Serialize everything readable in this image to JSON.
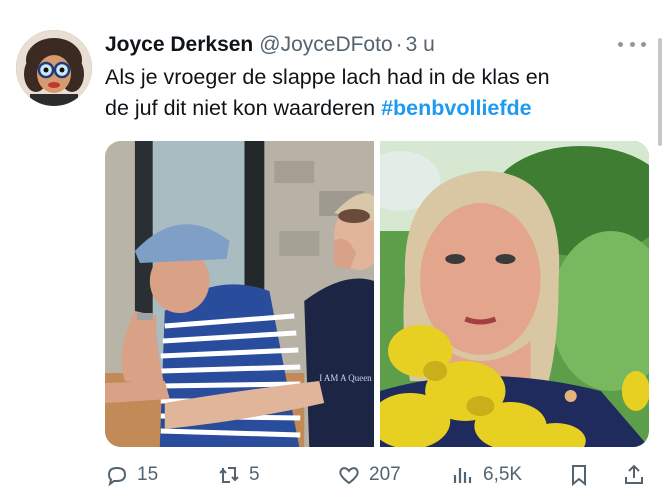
{
  "tweet": {
    "author_name": "Joyce Derksen",
    "author_handle": "@JoyceDFoto",
    "separator": "·",
    "time": "3 u",
    "text_line1": "Als je vroeger de slappe lach had in de klas en",
    "text_line2_prefix": "de juf dit niet kon waarderen ",
    "hashtag": "#benbvolliefde",
    "media_overlay_shirt": "I AM A Queen"
  },
  "actions": {
    "reply_count": "15",
    "retweet_count": "5",
    "like_count": "207",
    "views_count": "6,5K"
  },
  "icons": [
    "more-icon",
    "reply-icon",
    "retweet-icon",
    "like-icon",
    "views-icon",
    "bookmark-icon",
    "share-icon"
  ],
  "colors": {
    "hashtag": "#1d9bf0",
    "secondary_text": "#536471",
    "primary_text": "#0f1419"
  }
}
